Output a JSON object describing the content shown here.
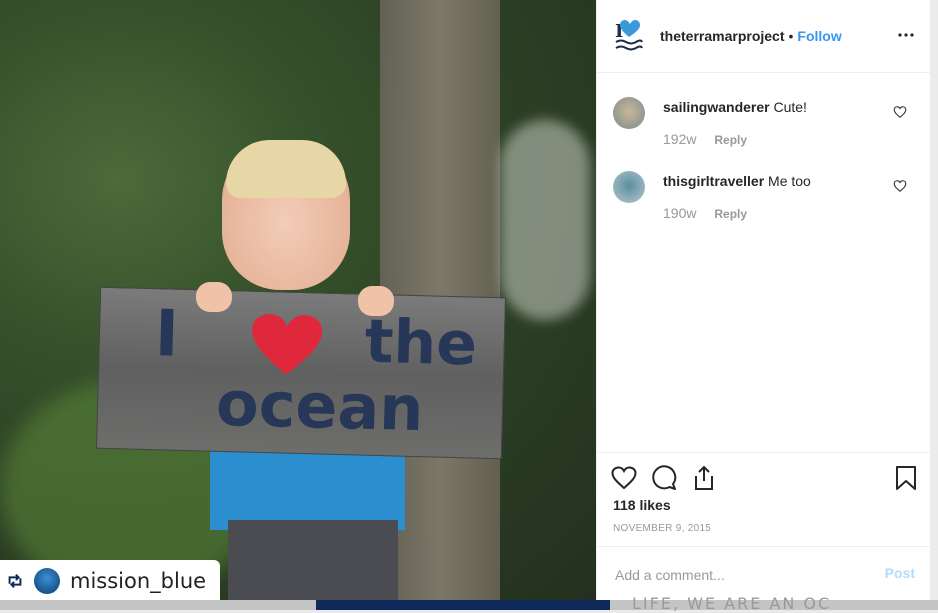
{
  "post": {
    "account": "theterramarproject",
    "follow_label": "Follow",
    "dot": "•",
    "likes": "118 likes",
    "date": "NOVEMBER 9, 2015",
    "add_comment_placeholder": "Add a comment...",
    "post_label": "Post"
  },
  "photo": {
    "sign_word1": "I",
    "sign_word2": "the",
    "sign_word3": "ocean",
    "repost_account": "mission_blue"
  },
  "comments": [
    {
      "user": "sailingwanderer",
      "text": "Cute!",
      "age": "192w",
      "reply": "Reply"
    },
    {
      "user": "thisgirltraveller",
      "text": "Me too",
      "age": "190w",
      "reply": "Reply"
    }
  ],
  "footer": {
    "ghost_text": "LIFE, WE ARE AN OC"
  },
  "colors": {
    "accent": "#3897f0",
    "heart": "#e0283c",
    "sign_ink": "#273757"
  }
}
